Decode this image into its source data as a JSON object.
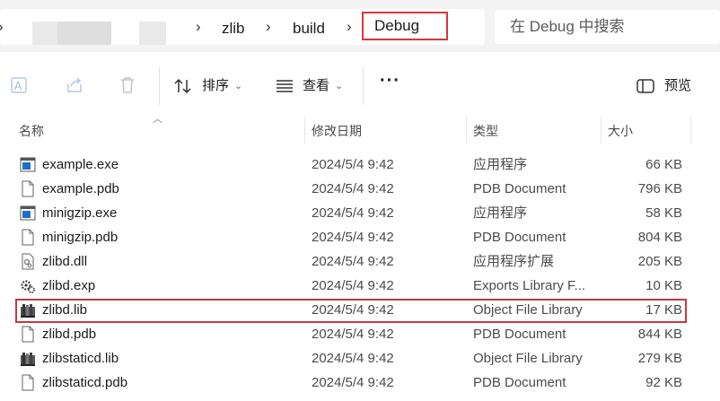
{
  "address": {
    "back_chevron": "›",
    "crumbs": [
      "zlib",
      "build"
    ],
    "current": "Debug",
    "search_placeholder": "在 Debug 中搜索"
  },
  "toolbar": {
    "sort_label": "排序",
    "view_label": "查看",
    "more_label": "···",
    "preview_label": "预览"
  },
  "columns": {
    "name": "名称",
    "modified": "修改日期",
    "type": "类型",
    "size": "大小"
  },
  "files": [
    {
      "name": "example.exe",
      "date": "2024/5/4 9:42",
      "type": "应用程序",
      "size": "66 KB",
      "icon": "exe-icon"
    },
    {
      "name": "example.pdb",
      "date": "2024/5/4 9:42",
      "type": "PDB Document",
      "size": "796 KB",
      "icon": "document-icon"
    },
    {
      "name": "minigzip.exe",
      "date": "2024/5/4 9:42",
      "type": "应用程序",
      "size": "58 KB",
      "icon": "exe-icon"
    },
    {
      "name": "minigzip.pdb",
      "date": "2024/5/4 9:42",
      "type": "PDB Document",
      "size": "804 KB",
      "icon": "document-icon"
    },
    {
      "name": "zlibd.dll",
      "date": "2024/5/4 9:42",
      "type": "应用程序扩展",
      "size": "205 KB",
      "icon": "dll-icon"
    },
    {
      "name": "zlibd.exp",
      "date": "2024/5/4 9:42",
      "type": "Exports Library F...",
      "size": "10 KB",
      "icon": "gear-file-icon"
    },
    {
      "name": "zlibd.lib",
      "date": "2024/5/4 9:42",
      "type": "Object File Library",
      "size": "17 KB",
      "icon": "library-icon"
    },
    {
      "name": "zlibd.pdb",
      "date": "2024/5/4 9:42",
      "type": "PDB Document",
      "size": "844 KB",
      "icon": "document-icon"
    },
    {
      "name": "zlibstaticd.lib",
      "date": "2024/5/4 9:42",
      "type": "Object File Library",
      "size": "279 KB",
      "icon": "library-icon"
    },
    {
      "name": "zlibstaticd.pdb",
      "date": "2024/5/4 9:42",
      "type": "PDB Document",
      "size": "92 KB",
      "icon": "document-icon"
    }
  ],
  "colors": {
    "highlight": "#c8373f",
    "exe_blue": "#1e6fc4"
  }
}
